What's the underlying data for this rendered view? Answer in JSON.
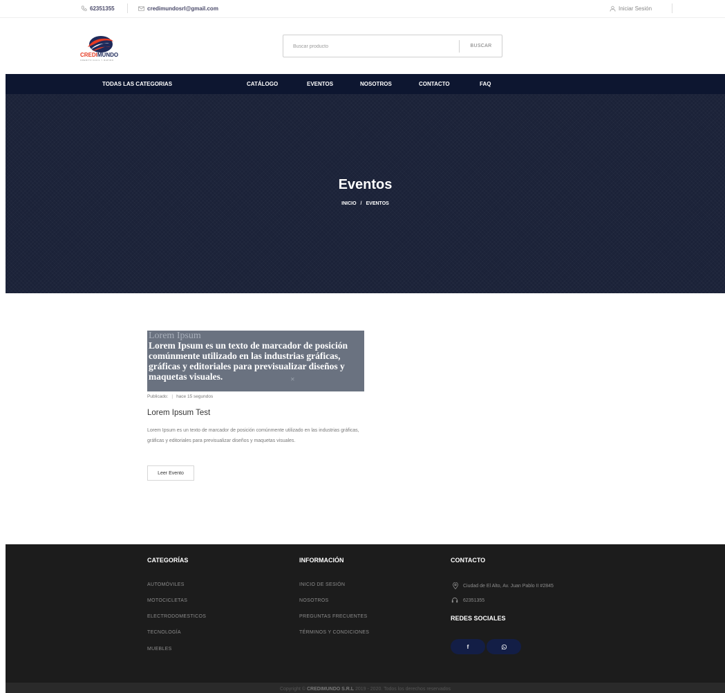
{
  "topbar": {
    "phone": "62351355",
    "email": "credimundosrl@gmail.com",
    "login": "Iniciar Sesión"
  },
  "brand": {
    "name_part1": "CREDI",
    "name_part2": "MUNDO",
    "tagline": "CREDITO FACIL Y RAPIDO",
    "colors": {
      "red": "#e63a23",
      "navy": "#1e2a5a"
    }
  },
  "search": {
    "placeholder": "Buscar producto",
    "button_label": "BUSCAR"
  },
  "nav": {
    "all_categories": "TODAS LAS CATEGORIAS",
    "items": [
      "CATÁLOGO",
      "EVENTOS",
      "NOSOTROS",
      "CONTACTO",
      "FAQ"
    ]
  },
  "hero": {
    "title": "Eventos",
    "breadcrumb_home": "INICIO",
    "breadcrumb_sep": "/",
    "breadcrumb_current": "EVENTOS"
  },
  "event": {
    "image_heading": "Lorem Ipsum",
    "image_text": "Lorem Ipsum es un texto de marcador de posición comúnmente utilizado en las industrias gráficas, gráficas y editoriales para previsualizar diseños y maquetas visuales.",
    "published_label": "Publicado:",
    "published_sep": "|",
    "published_time": "hace 15 segundos",
    "title": "Lorem Ipsum Test",
    "description": "Lorem Ipsum es un texto de marcador de posición comúnmente utilizado en las industrias gráficas, gráficas y editoriales para previsualizar diseños y maquetas visuales.",
    "button_label": "Leer Evento"
  },
  "footer": {
    "categories": {
      "title": "CATEGORÍAS",
      "items": [
        "AUTOMÓVILES",
        "MOTOCICLETAS",
        "ELECTRODOMESTICOS",
        "TECNOLOGÍA",
        "MUEBLES"
      ]
    },
    "information": {
      "title": "INFORMACIÓN",
      "items": [
        "INICIO DE SESIÓN",
        "NOSOTROS",
        "PREGUNTAS FRECUENTES",
        "TÉRMINOS Y CONDICIONES"
      ]
    },
    "contact": {
      "title": "CONTACTO",
      "address": "Ciudad de El Alto, Av. Juan Pablo II #2845",
      "phone": "62351355"
    },
    "social": {
      "title": "REDES SOCIALES",
      "facebook_label": "f",
      "whatsapp_icon": "whatsapp-icon"
    },
    "copyright_prefix": "Copyright ©",
    "copyright_company": "CREDIMUNDO S.R.L",
    "copyright_suffix": "2019 - 2020. Todos los derechos reservados"
  }
}
